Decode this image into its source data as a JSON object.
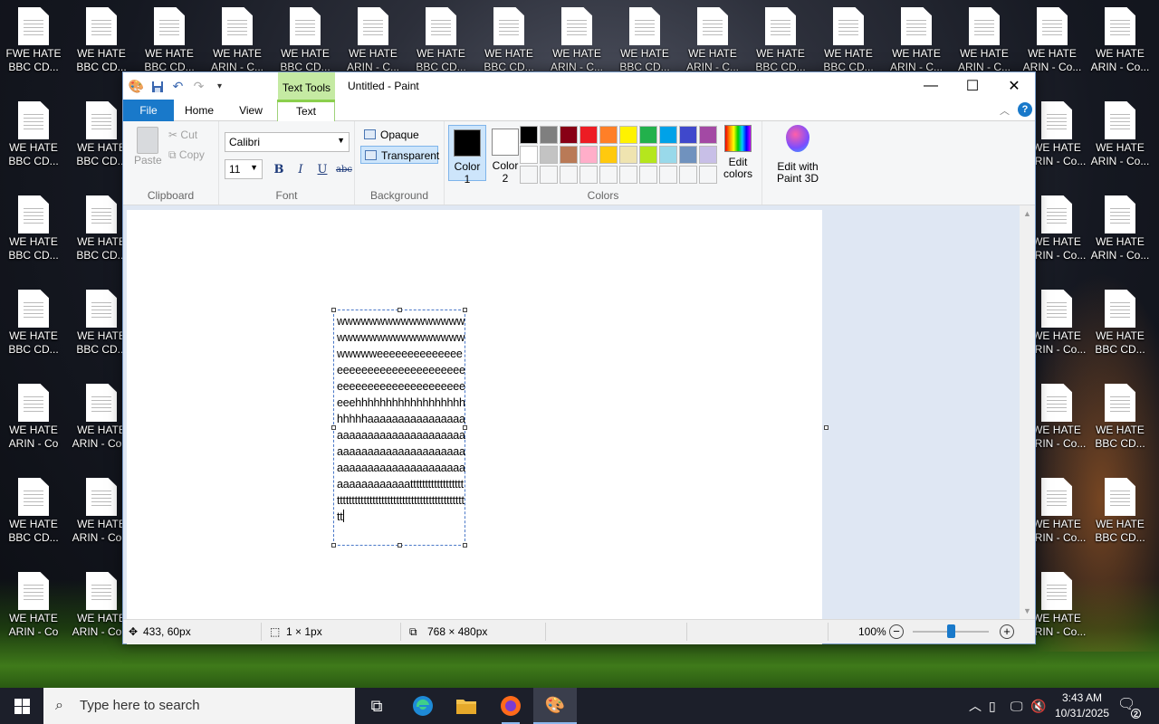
{
  "desktop": {
    "icons": [
      "FWE HATE\nBBC CD...",
      "WE HATE\nBBC CD...",
      "WE HATE\nBBC CD...",
      "WE HATE\nARIN - C...",
      "WE HATE\nBBC CD...",
      "WE HATE\nARIN - C...",
      "WE HATE\nBBC CD...",
      "WE HATE\nBBC CD...",
      "WE HATE\nARIN - C...",
      "WE HATE\nBBC CD...",
      "WE HATE\nARIN - C...",
      "WE HATE\nBBC CD...",
      "WE HATE\nBBC CD...",
      "WE HATE\nARIN - C...",
      "WE HATE\nARIN - C...",
      "WE HATE\nARIN - Co...",
      "WE HATE\nARIN - Co...",
      "WE HATE\nBBC CD...",
      "WE HATE\nBBC CD...",
      "WE HATE\nARIN - Co...",
      "WE HATE\nARIN - Co...",
      "WE HATE\nBBC CD...",
      "WE HATE\nBBC CD...",
      "WE HATE\nARIN - Co...",
      "WE HATE\nARIN - Co...",
      "WE HATE\nBBC CD...",
      "WE HATE\nBBC CD...",
      "WE HATE\nARIN - Co...",
      "WE HATE\nBBC CD...",
      "WE HATE\nARIN - Co",
      "WE HATE\nARIN - Co...",
      "WE HATE\nARIN - Co...",
      "WE HATE\nBBC CD...",
      "WE HATE\nBBC CD...",
      "WE HATE\nARIN - Co...",
      "WE HATE\nARIN - Co...",
      "WE HATE\nBBC CD...",
      "WE HATE\nARIN - Co",
      "WE HATE\nARIN - Co...",
      "WE HATE\nARIN - Co..."
    ]
  },
  "window": {
    "title": "Untitled - Paint",
    "context_tab": "Text Tools",
    "tabs": [
      "File",
      "Home",
      "View",
      "Text"
    ],
    "active_tab": "Text",
    "controls": {
      "minimize": "—",
      "maximize": "☐",
      "close": "✕"
    }
  },
  "ribbon": {
    "clipboard": {
      "label": "Clipboard",
      "paste": "Paste",
      "cut": "Cut",
      "copy": "Copy"
    },
    "font": {
      "label": "Font",
      "family": "Calibri",
      "size": "11",
      "bold": "B",
      "italic": "I",
      "underline": "U",
      "strike": "abc"
    },
    "background": {
      "label": "Background",
      "opaque": "Opaque",
      "transparent": "Transparent",
      "selected": "transparent"
    },
    "colors": {
      "label": "Colors",
      "color1": {
        "label": "Color\n1",
        "value": "#000000"
      },
      "color2": {
        "label": "Color\n2",
        "value": "#ffffff"
      },
      "palette": [
        "#000000",
        "#7f7f7f",
        "#880015",
        "#ed1c24",
        "#ff7f27",
        "#fff200",
        "#22b14c",
        "#00a2e8",
        "#3f48cc",
        "#a349a4",
        "#ffffff",
        "#c3c3c3",
        "#b97a57",
        "#ffaec9",
        "#ffc90e",
        "#efe4b0",
        "#b5e61d",
        "#99d9ea",
        "#7092be",
        "#c8bfe7",
        "#f5f6f7",
        "#f5f6f7",
        "#f5f6f7",
        "#f5f6f7",
        "#f5f6f7",
        "#f5f6f7",
        "#f5f6f7",
        "#f5f6f7",
        "#f5f6f7",
        "#f5f6f7"
      ],
      "edit_colors": "Edit\ncolors"
    },
    "paint3d": {
      "label": "Edit with\nPaint 3D"
    }
  },
  "canvas": {
    "text": "wwwwwwwwwwwwwwwwwwwwwwwwwwwwwwwwwwwwweeeeeeeeeeeeeeeeeeeeeeeeeeeeeeeeeeeeeeeeeeeeeeeeeeeeeeeeeeehhhhhhhhhhhhhhhhhhhhhhhaaaaaaaaaaaaaaaaaaaaaaaaaaaaaaaaaaaaaaaaaaaaaaaaaaaaaaaaaaaaaaaaaaaaaaaaaaaaaaaaaaaaaaaaaaattttttttttttttttttttttttttttttttttttttttttttttttttttttttttttttt"
  },
  "status": {
    "position": "433, 60px",
    "selection": "1 × 1px",
    "canvas_size": "768 × 480px",
    "zoom": "100%",
    "zoom_level": 1.0
  },
  "taskbar": {
    "search_placeholder": "Type here to search",
    "time": "3:43 AM",
    "date": "10/31/2025",
    "notifications": "2"
  }
}
